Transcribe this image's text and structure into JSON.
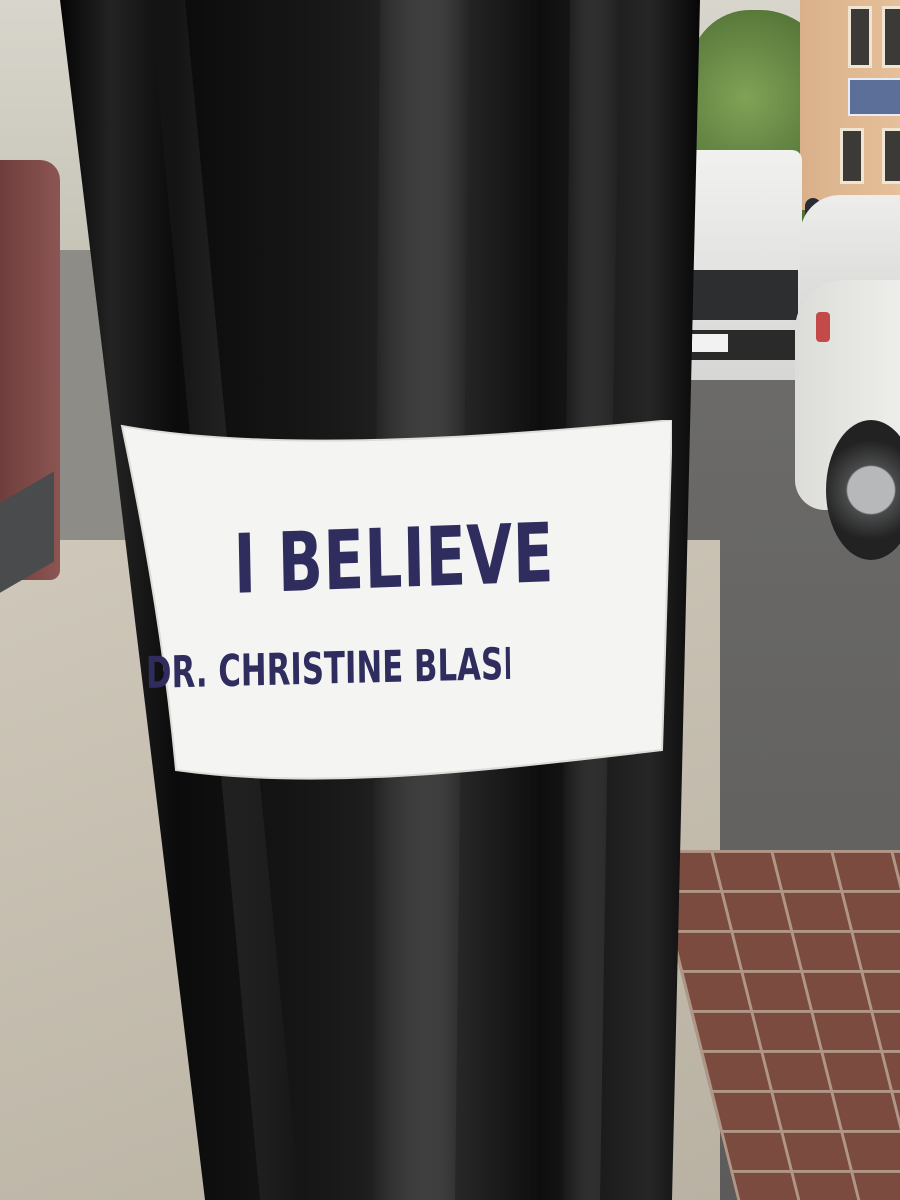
{
  "photo": {
    "subject": "sticker-on-lamp-post",
    "colors": {
      "pole": "#141414",
      "sticker": "#f4f4f2",
      "ink": "#2e2d5e",
      "sidewalk": "#c6bfb1",
      "road": "#666563",
      "brick": "#7a4b3e"
    }
  },
  "sticker": {
    "line1": "I BELIEVE",
    "line2": "DR. CHRISTINE BLASEY FORD"
  }
}
